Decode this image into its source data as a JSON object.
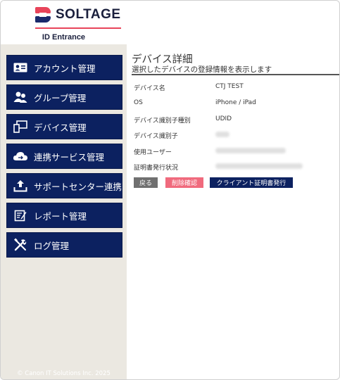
{
  "brand": {
    "logo_text": "SOLTAGE",
    "subtitle": "ID Entrance",
    "copyright": "© Canon IT Solutions Inc. 2025"
  },
  "sidebar": {
    "items": [
      {
        "label": "アカウント管理",
        "icon": "id-card-icon"
      },
      {
        "label": "グループ管理",
        "icon": "users-icon"
      },
      {
        "label": "デバイス管理",
        "icon": "devices-icon"
      },
      {
        "label": "連携サービス管理",
        "icon": "cloud-icon"
      },
      {
        "label": "サポートセンター連携",
        "icon": "upload-icon"
      },
      {
        "label": "レポート管理",
        "icon": "report-icon"
      },
      {
        "label": "ログ管理",
        "icon": "tools-icon"
      }
    ]
  },
  "page": {
    "title": "デバイス詳細",
    "subtitle": "選択したデバイスの登録情報を表示します",
    "fields": [
      {
        "label": "デバイス名",
        "value": "CTJ TEST"
      },
      {
        "label": "OS",
        "value": "iPhone / iPad"
      },
      {
        "label": "デバイス識別子種別",
        "value": "UDID"
      },
      {
        "label": "デバイス識別子",
        "value": ""
      },
      {
        "label": "使用ユーザー",
        "value": ""
      },
      {
        "label": "証明書発行状況",
        "value": ""
      }
    ],
    "buttons": {
      "back": "戻る",
      "delete": "削除確認",
      "cert": "クライアント証明書発行"
    }
  },
  "colors": {
    "nav_bg": "#0c2160",
    "accent": "#e8445a",
    "sidebar_bg": "#ebe8e1",
    "delete_btn": "#f06a7d"
  }
}
